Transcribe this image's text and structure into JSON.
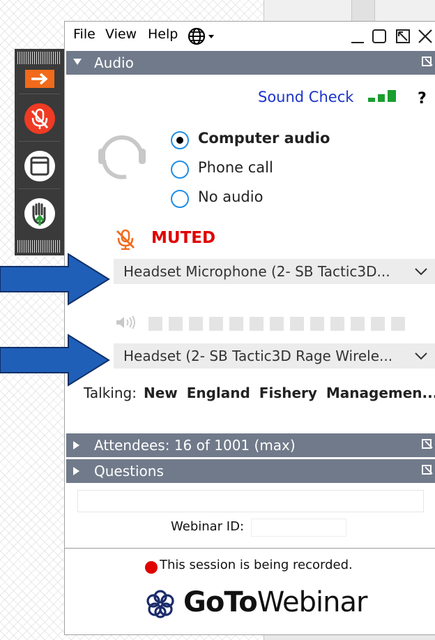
{
  "menu": {
    "file": "File",
    "view": "View",
    "help": "Help"
  },
  "sections": {
    "audio": "Audio",
    "attendees": "Attendees:  16 of 1001 (max)",
    "questions": "Questions"
  },
  "audio": {
    "sound_check": "Sound Check",
    "help_glyph": "?",
    "options": [
      {
        "label": "Computer audio",
        "selected": true
      },
      {
        "label": "Phone call",
        "selected": false
      },
      {
        "label": "No audio",
        "selected": false
      }
    ],
    "muted": "MUTED",
    "microphone": "Headset Microphone (2- SB Tactic3D...",
    "speaker": "Headset (2- SB Tactic3D Rage Wirele...",
    "talking_label": "Talking:",
    "talking_value": "New England Fishery Managemen..."
  },
  "footer": {
    "webinar_id_label": "Webinar ID:",
    "recording": "This session is being recorded.",
    "brand_bold": "GoTo",
    "brand_light": "Webinar"
  },
  "colors": {
    "accent": "#1a33cc",
    "muted": "#e00000",
    "section_bar": "#707a8a",
    "arrow": "#1f5fb8"
  }
}
